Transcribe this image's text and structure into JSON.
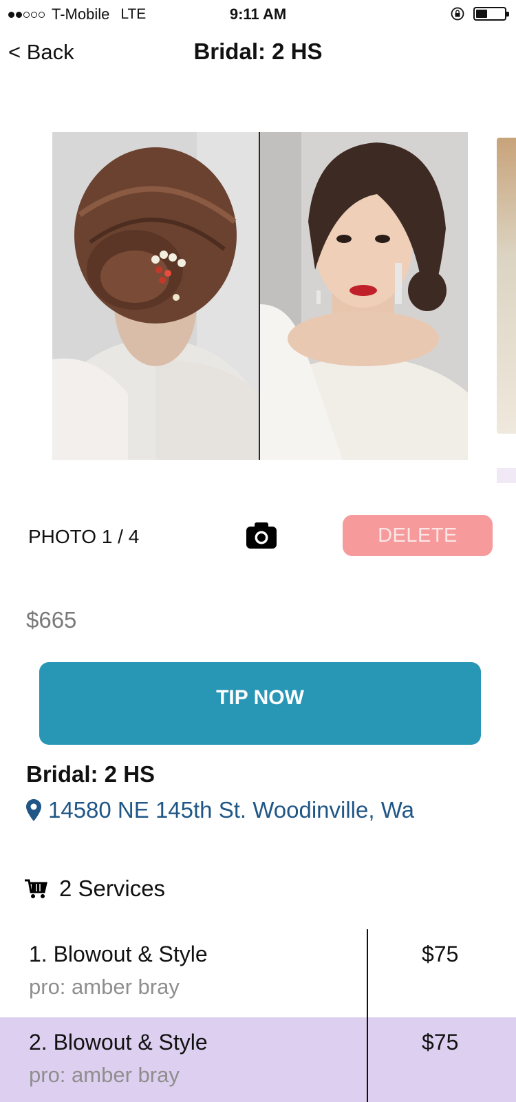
{
  "status_bar": {
    "carrier": "T-Mobile",
    "network": "LTE",
    "time": "9:11 AM"
  },
  "nav": {
    "back_label": "< Back",
    "title": "Bridal: 2 HS"
  },
  "gallery": {
    "counter": "PHOTO 1 / 4",
    "delete_label": "DELETE"
  },
  "price": "$665",
  "tip_label": "TIP NOW",
  "event": {
    "title": "Bridal: 2 HS",
    "address": "14580 NE 145th St. Woodinville, Wa"
  },
  "services": {
    "count_label": "2 Services",
    "items": [
      {
        "name": "1. Blowout & Style",
        "pro": "pro: amber bray",
        "price": "$75"
      },
      {
        "name": "2. Blowout & Style",
        "pro": "pro: amber bray",
        "price": "$75"
      }
    ]
  },
  "colors": {
    "tip_button": "#2896b5",
    "delete_button": "#f79a9c",
    "address": "#1f5686",
    "highlight_row": "#ddcfef"
  },
  "icons": {
    "camera": "camera-icon",
    "location": "map-pin-icon",
    "cart": "cart-icon"
  }
}
